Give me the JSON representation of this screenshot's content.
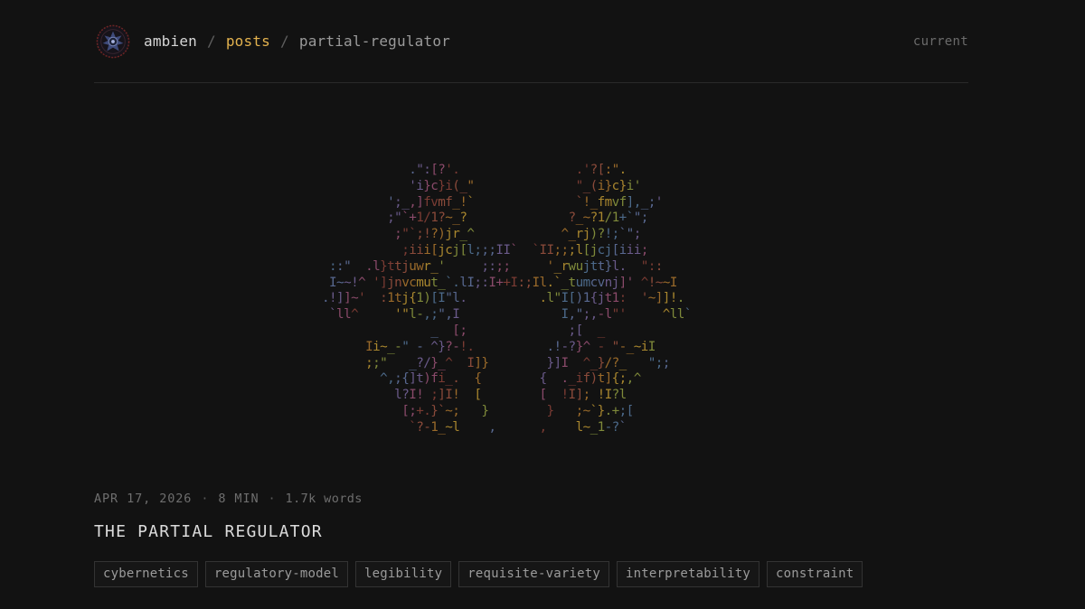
{
  "header": {
    "logo_icon": "eye-gear-logo",
    "breadcrumb": {
      "home": "ambien",
      "separator": "/",
      "section": "posts",
      "current": "partial-regulator"
    },
    "status": "current"
  },
  "art": {
    "lines": [
      "             .\":[?'.                .'?[:\".",
      "             'i}c}i(_\"              \"_(i}c}i'",
      "          ';_,]fvmf_!`              `!_fmvf],_;'",
      "          ;\"`+1/1?~_?              ?_~?1/1+`\";",
      "           ;\"`;!?)jr_^            ^_rj)?!;`\";",
      "            ;iii[jcj[l;;;II`  `II;;;l[jcj[iii;",
      "  ::\"  .l}ttjuwr_'     ;:;;     '_rwujtt}l.  \"::",
      "  I~~!^ ']jnvcmut_`.lI;:I++I:;Il.`_tumcvnj]' ^!~~I",
      " .!]]~'  :1tj{1)[I\"l.          .l\"I[)1{jt1:  '~]]!.",
      "  `ll^     '\"l-,;\",I              I,\";,-l\"'     ^ll`",
      "                _  [;              ;[  _",
      "       Ii~_-\" - ^}?-!.          .!-?}^ - \"-_~iI",
      "       ;;\"   _?/}_^  I]}        }]I  ^_}/?_   \";;",
      "         ^,;{]t)fi_.  {        {  ._if)t]{;,^",
      "           l?I! ;]I!  [        [  !I]; !I?l",
      "            [;+.}`~;   }        }   ;~`}.+;[",
      "             `?-1_~l    ,      ,    l~_1-?`"
    ],
    "palette": [
      "#7a3b33",
      "#8a4a3a",
      "#9a6a2a",
      "#a8862e",
      "#7f8a3a",
      "#4c6a8a",
      "#586890",
      "#6a5a8a",
      "#8a4a6a"
    ]
  },
  "post": {
    "date": "APR 17, 2026",
    "separator": "·",
    "read_time": "8 MIN",
    "word_count": "1.7k words",
    "title": "THE PARTIAL REGULATOR",
    "tags": [
      "cybernetics",
      "regulatory-model",
      "legibility",
      "requisite-variety",
      "interpretability",
      "constraint"
    ]
  }
}
